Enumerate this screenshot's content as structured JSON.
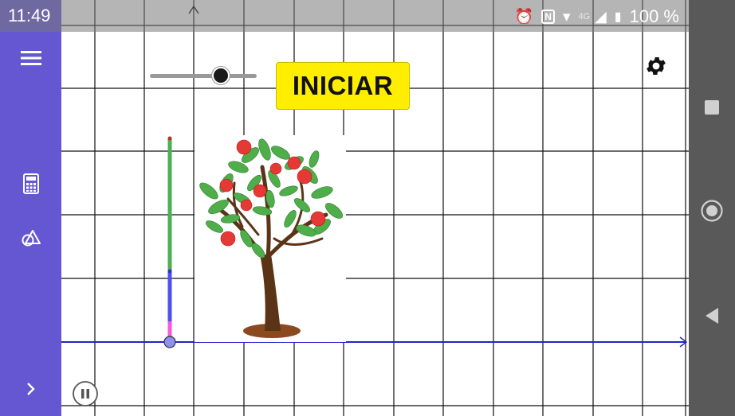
{
  "status_bar": {
    "time": "11:49",
    "network": "4G",
    "battery": "100 %",
    "icons": [
      "alarm-icon",
      "nfc-icon",
      "wifi-icon",
      "signal-icon",
      "battery-icon"
    ]
  },
  "toolbar": {
    "background": "#6557d2",
    "items": [
      "menu-icon",
      "calculator-icon",
      "geometry-icon",
      "chevron-right-icon"
    ]
  },
  "canvas": {
    "start_button_label": "INICIAR",
    "start_button_color": "#ffee00",
    "slider_value": 0.68,
    "axis_color": "#2323c8",
    "measure_bar_colors": [
      "#4caf50",
      "#5050f0",
      "#ff55dd"
    ]
  },
  "nav_bar": {
    "items": [
      "recents-icon",
      "home-icon",
      "back-icon"
    ]
  }
}
